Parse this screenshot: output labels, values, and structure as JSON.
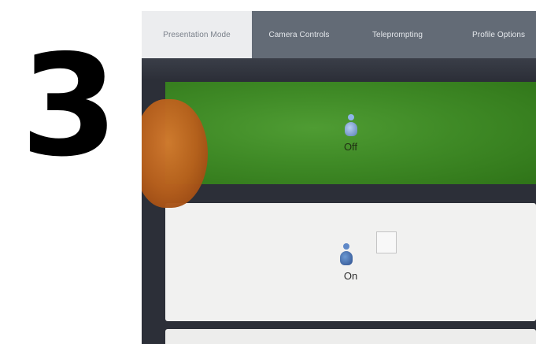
{
  "step": {
    "number": "3"
  },
  "tabs": [
    {
      "label": "Presentation Mode",
      "active": true
    },
    {
      "label": "Camera Controls",
      "active": false
    },
    {
      "label": "Teleprompting",
      "active": false
    },
    {
      "label": "Profile Options",
      "active": false
    }
  ],
  "options": {
    "off": {
      "label": "Off",
      "icon": "person-icon",
      "highlighted": true,
      "color": "#3f8a26"
    },
    "on": {
      "label": "On",
      "icon": "person-icon",
      "highlighted": false
    }
  }
}
